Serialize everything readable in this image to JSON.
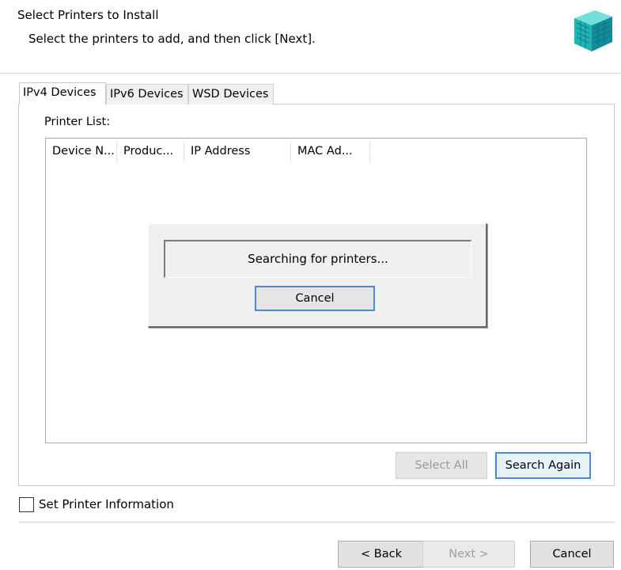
{
  "header": {
    "title": "Select Printers to Install",
    "subtitle": "Select the printers to add, and then click [Next].",
    "logo_icon": "printer-cube-icon"
  },
  "tabs": [
    {
      "label": "IPv4 Devices",
      "active": true
    },
    {
      "label": "IPv6 Devices",
      "active": false
    },
    {
      "label": "WSD Devices",
      "active": false
    }
  ],
  "printer_list": {
    "label": "Printer List:",
    "columns": [
      "Device N...",
      "Produc...",
      "IP Address",
      "MAC Ad..."
    ],
    "rows": []
  },
  "search_dialog": {
    "status": "Searching for printers...",
    "cancel_label": "Cancel"
  },
  "list_buttons": {
    "select_all": "Select All",
    "search_again": "Search Again"
  },
  "options": {
    "set_printer_info_label": "Set Printer Information",
    "set_printer_info_checked": false
  },
  "wizard_buttons": {
    "back": "< Back",
    "next": "Next >",
    "cancel": "Cancel"
  },
  "colors": {
    "focus_border": "#4a8ad6",
    "disabled_text": "#9a9a9a",
    "logo_teal": "#1fb5b5"
  }
}
